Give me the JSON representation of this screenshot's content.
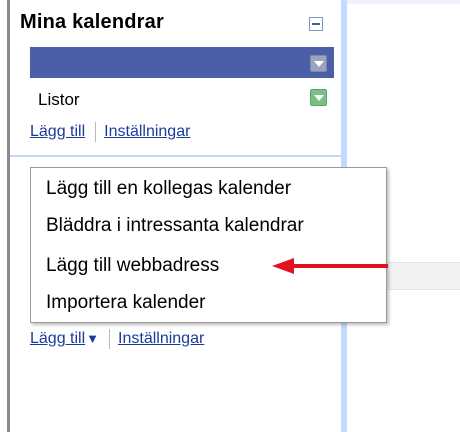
{
  "sidebar": {
    "my_calendars_title": "Mina kalendrar",
    "calendars": [
      {
        "label": "",
        "selected": true,
        "color": "#4a5fa8"
      },
      {
        "label": "Listor",
        "selected": false,
        "color": "#7bbf86"
      }
    ],
    "add_label": "Lägg till",
    "settings_label": "Inställningar"
  },
  "other_section": {
    "add_label": "Lägg till",
    "add_arrow": "▼",
    "settings_label": "Inställningar"
  },
  "menu": {
    "items": [
      "Lägg till en kollegas kalender",
      "Bläddra i intressanta kalendrar",
      "Lägg till webbadress",
      "Importera kalender"
    ]
  },
  "colors": {
    "link": "#1a3b9e",
    "sidebar_border": "#c3d9ff",
    "annotation_arrow": "#e0121f"
  },
  "icons": {
    "collapse": "minus-icon",
    "calendar_dropdown": "chevron-down-icon",
    "annotation": "red-arrow-icon"
  }
}
